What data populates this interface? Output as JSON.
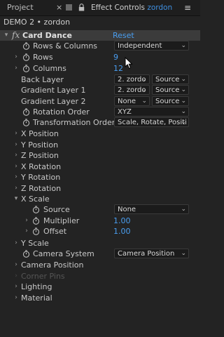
{
  "tabs": {
    "project": "Project",
    "effect_controls_prefix": "Effect Controls",
    "effect_controls_layer": "zordon"
  },
  "breadcrumb": "DEMO 2 • zordon",
  "effect": {
    "name": "Card Dance",
    "reset_label": "Reset"
  },
  "params": {
    "rows_columns": {
      "label": "Rows & Columns",
      "value": "Independent"
    },
    "rows": {
      "label": "Rows",
      "value": "9"
    },
    "columns": {
      "label": "Columns",
      "value": "12"
    },
    "back_layer": {
      "label": "Back Layer",
      "value": "2. zordo",
      "source": "Source"
    },
    "gradient_layer_1": {
      "label": "Gradient Layer 1",
      "value": "2. zordo",
      "source": "Source"
    },
    "gradient_layer_2": {
      "label": "Gradient Layer 2",
      "value": "None",
      "source": "Source"
    },
    "rotation_order": {
      "label": "Rotation Order",
      "value": "XYZ"
    },
    "transformation_order": {
      "label": "Transformation Order",
      "value": "Scale, Rotate, Positi"
    },
    "x_position": "X Position",
    "y_position": "Y Position",
    "z_position": "Z Position",
    "x_rotation": "X Rotation",
    "y_rotation": "Y Rotation",
    "z_rotation": "Z Rotation",
    "x_scale": {
      "label": "X Scale",
      "source": {
        "label": "Source",
        "value": "None"
      },
      "multiplier": {
        "label": "Multiplier",
        "value": "1.00"
      },
      "offset": {
        "label": "Offset",
        "value": "1.00"
      }
    },
    "y_scale": "Y Scale",
    "camera_system": {
      "label": "Camera System",
      "value": "Camera Position"
    },
    "camera_position": "Camera Position",
    "corner_pins": "Corner Pins",
    "lighting": "Lighting",
    "material": "Material"
  },
  "icons": {
    "twirl_open": "▾",
    "twirl_closed": "›",
    "dropdown_chevron": "⌄",
    "close": "×",
    "lock": "🔒",
    "menu": "≡"
  },
  "colors": {
    "value_blue": "#4a9ef0",
    "background": "#232323",
    "header_row": "#3b3b3b"
  }
}
